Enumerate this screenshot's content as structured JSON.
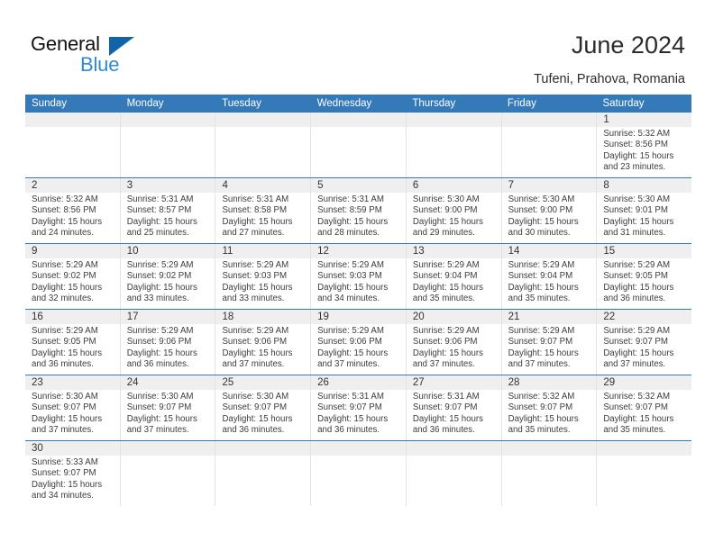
{
  "brand": {
    "name_part1": "General",
    "name_part2": "Blue",
    "triangle_icon": "triangle-icon",
    "colors": {
      "dark": "#14110f",
      "blue": "#2e8bd4",
      "triangle": "#1264aa"
    }
  },
  "header": {
    "title": "June 2024",
    "subtitle": "Tufeni, Prahova, Romania"
  },
  "calendar": {
    "accent_color": "#3479b8",
    "daystrip_color": "#efefef",
    "weekday_headers": [
      "Sunday",
      "Monday",
      "Tuesday",
      "Wednesday",
      "Thursday",
      "Friday",
      "Saturday"
    ],
    "labels": {
      "sunrise": "Sunrise:",
      "sunset": "Sunset:",
      "daylight": "Daylight:"
    },
    "weeks": [
      [
        {
          "day": ""
        },
        {
          "day": ""
        },
        {
          "day": ""
        },
        {
          "day": ""
        },
        {
          "day": ""
        },
        {
          "day": ""
        },
        {
          "day": "1",
          "sunrise": "Sunrise: 5:32 AM",
          "sunset": "Sunset: 8:56 PM",
          "daylight_line1": "Daylight: 15 hours",
          "daylight_line2": "and 23 minutes."
        }
      ],
      [
        {
          "day": "2",
          "sunrise": "Sunrise: 5:32 AM",
          "sunset": "Sunset: 8:56 PM",
          "daylight_line1": "Daylight: 15 hours",
          "daylight_line2": "and 24 minutes."
        },
        {
          "day": "3",
          "sunrise": "Sunrise: 5:31 AM",
          "sunset": "Sunset: 8:57 PM",
          "daylight_line1": "Daylight: 15 hours",
          "daylight_line2": "and 25 minutes."
        },
        {
          "day": "4",
          "sunrise": "Sunrise: 5:31 AM",
          "sunset": "Sunset: 8:58 PM",
          "daylight_line1": "Daylight: 15 hours",
          "daylight_line2": "and 27 minutes."
        },
        {
          "day": "5",
          "sunrise": "Sunrise: 5:31 AM",
          "sunset": "Sunset: 8:59 PM",
          "daylight_line1": "Daylight: 15 hours",
          "daylight_line2": "and 28 minutes."
        },
        {
          "day": "6",
          "sunrise": "Sunrise: 5:30 AM",
          "sunset": "Sunset: 9:00 PM",
          "daylight_line1": "Daylight: 15 hours",
          "daylight_line2": "and 29 minutes."
        },
        {
          "day": "7",
          "sunrise": "Sunrise: 5:30 AM",
          "sunset": "Sunset: 9:00 PM",
          "daylight_line1": "Daylight: 15 hours",
          "daylight_line2": "and 30 minutes."
        },
        {
          "day": "8",
          "sunrise": "Sunrise: 5:30 AM",
          "sunset": "Sunset: 9:01 PM",
          "daylight_line1": "Daylight: 15 hours",
          "daylight_line2": "and 31 minutes."
        }
      ],
      [
        {
          "day": "9",
          "sunrise": "Sunrise: 5:29 AM",
          "sunset": "Sunset: 9:02 PM",
          "daylight_line1": "Daylight: 15 hours",
          "daylight_line2": "and 32 minutes."
        },
        {
          "day": "10",
          "sunrise": "Sunrise: 5:29 AM",
          "sunset": "Sunset: 9:02 PM",
          "daylight_line1": "Daylight: 15 hours",
          "daylight_line2": "and 33 minutes."
        },
        {
          "day": "11",
          "sunrise": "Sunrise: 5:29 AM",
          "sunset": "Sunset: 9:03 PM",
          "daylight_line1": "Daylight: 15 hours",
          "daylight_line2": "and 33 minutes."
        },
        {
          "day": "12",
          "sunrise": "Sunrise: 5:29 AM",
          "sunset": "Sunset: 9:03 PM",
          "daylight_line1": "Daylight: 15 hours",
          "daylight_line2": "and 34 minutes."
        },
        {
          "day": "13",
          "sunrise": "Sunrise: 5:29 AM",
          "sunset": "Sunset: 9:04 PM",
          "daylight_line1": "Daylight: 15 hours",
          "daylight_line2": "and 35 minutes."
        },
        {
          "day": "14",
          "sunrise": "Sunrise: 5:29 AM",
          "sunset": "Sunset: 9:04 PM",
          "daylight_line1": "Daylight: 15 hours",
          "daylight_line2": "and 35 minutes."
        },
        {
          "day": "15",
          "sunrise": "Sunrise: 5:29 AM",
          "sunset": "Sunset: 9:05 PM",
          "daylight_line1": "Daylight: 15 hours",
          "daylight_line2": "and 36 minutes."
        }
      ],
      [
        {
          "day": "16",
          "sunrise": "Sunrise: 5:29 AM",
          "sunset": "Sunset: 9:05 PM",
          "daylight_line1": "Daylight: 15 hours",
          "daylight_line2": "and 36 minutes."
        },
        {
          "day": "17",
          "sunrise": "Sunrise: 5:29 AM",
          "sunset": "Sunset: 9:06 PM",
          "daylight_line1": "Daylight: 15 hours",
          "daylight_line2": "and 36 minutes."
        },
        {
          "day": "18",
          "sunrise": "Sunrise: 5:29 AM",
          "sunset": "Sunset: 9:06 PM",
          "daylight_line1": "Daylight: 15 hours",
          "daylight_line2": "and 37 minutes."
        },
        {
          "day": "19",
          "sunrise": "Sunrise: 5:29 AM",
          "sunset": "Sunset: 9:06 PM",
          "daylight_line1": "Daylight: 15 hours",
          "daylight_line2": "and 37 minutes."
        },
        {
          "day": "20",
          "sunrise": "Sunrise: 5:29 AM",
          "sunset": "Sunset: 9:06 PM",
          "daylight_line1": "Daylight: 15 hours",
          "daylight_line2": "and 37 minutes."
        },
        {
          "day": "21",
          "sunrise": "Sunrise: 5:29 AM",
          "sunset": "Sunset: 9:07 PM",
          "daylight_line1": "Daylight: 15 hours",
          "daylight_line2": "and 37 minutes."
        },
        {
          "day": "22",
          "sunrise": "Sunrise: 5:29 AM",
          "sunset": "Sunset: 9:07 PM",
          "daylight_line1": "Daylight: 15 hours",
          "daylight_line2": "and 37 minutes."
        }
      ],
      [
        {
          "day": "23",
          "sunrise": "Sunrise: 5:30 AM",
          "sunset": "Sunset: 9:07 PM",
          "daylight_line1": "Daylight: 15 hours",
          "daylight_line2": "and 37 minutes."
        },
        {
          "day": "24",
          "sunrise": "Sunrise: 5:30 AM",
          "sunset": "Sunset: 9:07 PM",
          "daylight_line1": "Daylight: 15 hours",
          "daylight_line2": "and 37 minutes."
        },
        {
          "day": "25",
          "sunrise": "Sunrise: 5:30 AM",
          "sunset": "Sunset: 9:07 PM",
          "daylight_line1": "Daylight: 15 hours",
          "daylight_line2": "and 36 minutes."
        },
        {
          "day": "26",
          "sunrise": "Sunrise: 5:31 AM",
          "sunset": "Sunset: 9:07 PM",
          "daylight_line1": "Daylight: 15 hours",
          "daylight_line2": "and 36 minutes."
        },
        {
          "day": "27",
          "sunrise": "Sunrise: 5:31 AM",
          "sunset": "Sunset: 9:07 PM",
          "daylight_line1": "Daylight: 15 hours",
          "daylight_line2": "and 36 minutes."
        },
        {
          "day": "28",
          "sunrise": "Sunrise: 5:32 AM",
          "sunset": "Sunset: 9:07 PM",
          "daylight_line1": "Daylight: 15 hours",
          "daylight_line2": "and 35 minutes."
        },
        {
          "day": "29",
          "sunrise": "Sunrise: 5:32 AM",
          "sunset": "Sunset: 9:07 PM",
          "daylight_line1": "Daylight: 15 hours",
          "daylight_line2": "and 35 minutes."
        }
      ],
      [
        {
          "day": "30",
          "sunrise": "Sunrise: 5:33 AM",
          "sunset": "Sunset: 9:07 PM",
          "daylight_line1": "Daylight: 15 hours",
          "daylight_line2": "and 34 minutes."
        },
        {
          "day": ""
        },
        {
          "day": ""
        },
        {
          "day": ""
        },
        {
          "day": ""
        },
        {
          "day": ""
        },
        {
          "day": ""
        }
      ]
    ]
  }
}
